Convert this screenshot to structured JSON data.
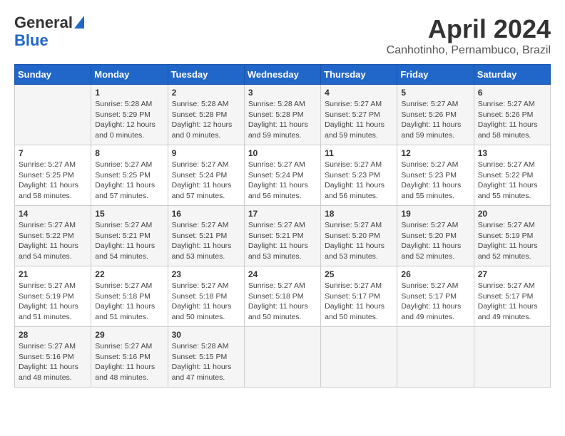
{
  "header": {
    "logo_line1": "General",
    "logo_line2": "Blue",
    "month_title": "April 2024",
    "subtitle": "Canhotinho, Pernambuco, Brazil"
  },
  "days_of_week": [
    "Sunday",
    "Monday",
    "Tuesday",
    "Wednesday",
    "Thursday",
    "Friday",
    "Saturday"
  ],
  "weeks": [
    [
      {
        "day": "",
        "info": ""
      },
      {
        "day": "1",
        "info": "Sunrise: 5:28 AM\nSunset: 5:29 PM\nDaylight: 12 hours\nand 0 minutes."
      },
      {
        "day": "2",
        "info": "Sunrise: 5:28 AM\nSunset: 5:28 PM\nDaylight: 12 hours\nand 0 minutes."
      },
      {
        "day": "3",
        "info": "Sunrise: 5:28 AM\nSunset: 5:28 PM\nDaylight: 11 hours\nand 59 minutes."
      },
      {
        "day": "4",
        "info": "Sunrise: 5:27 AM\nSunset: 5:27 PM\nDaylight: 11 hours\nand 59 minutes."
      },
      {
        "day": "5",
        "info": "Sunrise: 5:27 AM\nSunset: 5:26 PM\nDaylight: 11 hours\nand 59 minutes."
      },
      {
        "day": "6",
        "info": "Sunrise: 5:27 AM\nSunset: 5:26 PM\nDaylight: 11 hours\nand 58 minutes."
      }
    ],
    [
      {
        "day": "7",
        "info": "Sunrise: 5:27 AM\nSunset: 5:25 PM\nDaylight: 11 hours\nand 58 minutes."
      },
      {
        "day": "8",
        "info": "Sunrise: 5:27 AM\nSunset: 5:25 PM\nDaylight: 11 hours\nand 57 minutes."
      },
      {
        "day": "9",
        "info": "Sunrise: 5:27 AM\nSunset: 5:24 PM\nDaylight: 11 hours\nand 57 minutes."
      },
      {
        "day": "10",
        "info": "Sunrise: 5:27 AM\nSunset: 5:24 PM\nDaylight: 11 hours\nand 56 minutes."
      },
      {
        "day": "11",
        "info": "Sunrise: 5:27 AM\nSunset: 5:23 PM\nDaylight: 11 hours\nand 56 minutes."
      },
      {
        "day": "12",
        "info": "Sunrise: 5:27 AM\nSunset: 5:23 PM\nDaylight: 11 hours\nand 55 minutes."
      },
      {
        "day": "13",
        "info": "Sunrise: 5:27 AM\nSunset: 5:22 PM\nDaylight: 11 hours\nand 55 minutes."
      }
    ],
    [
      {
        "day": "14",
        "info": "Sunrise: 5:27 AM\nSunset: 5:22 PM\nDaylight: 11 hours\nand 54 minutes."
      },
      {
        "day": "15",
        "info": "Sunrise: 5:27 AM\nSunset: 5:21 PM\nDaylight: 11 hours\nand 54 minutes."
      },
      {
        "day": "16",
        "info": "Sunrise: 5:27 AM\nSunset: 5:21 PM\nDaylight: 11 hours\nand 53 minutes."
      },
      {
        "day": "17",
        "info": "Sunrise: 5:27 AM\nSunset: 5:21 PM\nDaylight: 11 hours\nand 53 minutes."
      },
      {
        "day": "18",
        "info": "Sunrise: 5:27 AM\nSunset: 5:20 PM\nDaylight: 11 hours\nand 53 minutes."
      },
      {
        "day": "19",
        "info": "Sunrise: 5:27 AM\nSunset: 5:20 PM\nDaylight: 11 hours\nand 52 minutes."
      },
      {
        "day": "20",
        "info": "Sunrise: 5:27 AM\nSunset: 5:19 PM\nDaylight: 11 hours\nand 52 minutes."
      }
    ],
    [
      {
        "day": "21",
        "info": "Sunrise: 5:27 AM\nSunset: 5:19 PM\nDaylight: 11 hours\nand 51 minutes."
      },
      {
        "day": "22",
        "info": "Sunrise: 5:27 AM\nSunset: 5:18 PM\nDaylight: 11 hours\nand 51 minutes."
      },
      {
        "day": "23",
        "info": "Sunrise: 5:27 AM\nSunset: 5:18 PM\nDaylight: 11 hours\nand 50 minutes."
      },
      {
        "day": "24",
        "info": "Sunrise: 5:27 AM\nSunset: 5:18 PM\nDaylight: 11 hours\nand 50 minutes."
      },
      {
        "day": "25",
        "info": "Sunrise: 5:27 AM\nSunset: 5:17 PM\nDaylight: 11 hours\nand 50 minutes."
      },
      {
        "day": "26",
        "info": "Sunrise: 5:27 AM\nSunset: 5:17 PM\nDaylight: 11 hours\nand 49 minutes."
      },
      {
        "day": "27",
        "info": "Sunrise: 5:27 AM\nSunset: 5:17 PM\nDaylight: 11 hours\nand 49 minutes."
      }
    ],
    [
      {
        "day": "28",
        "info": "Sunrise: 5:27 AM\nSunset: 5:16 PM\nDaylight: 11 hours\nand 48 minutes."
      },
      {
        "day": "29",
        "info": "Sunrise: 5:27 AM\nSunset: 5:16 PM\nDaylight: 11 hours\nand 48 minutes."
      },
      {
        "day": "30",
        "info": "Sunrise: 5:28 AM\nSunset: 5:15 PM\nDaylight: 11 hours\nand 47 minutes."
      },
      {
        "day": "",
        "info": ""
      },
      {
        "day": "",
        "info": ""
      },
      {
        "day": "",
        "info": ""
      },
      {
        "day": "",
        "info": ""
      }
    ]
  ]
}
